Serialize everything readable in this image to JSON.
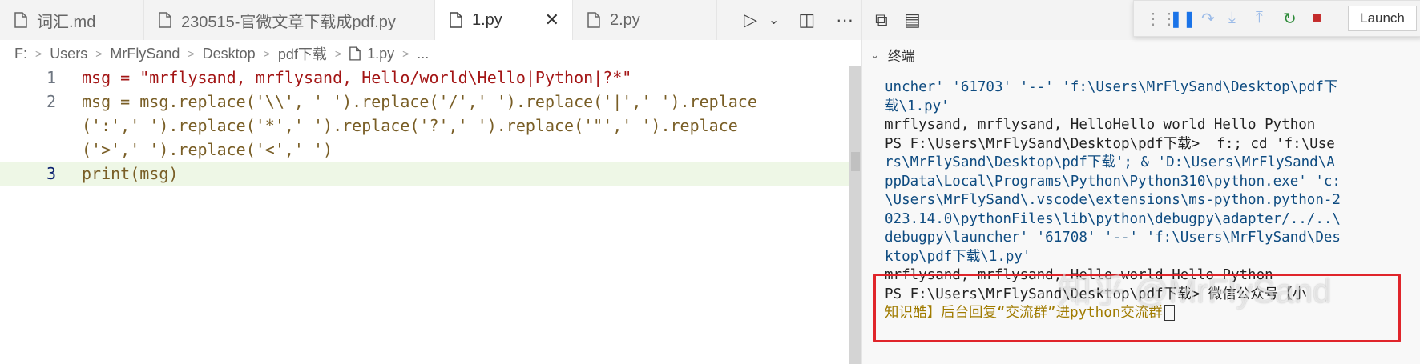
{
  "tabs": [
    {
      "label": "词汇.md",
      "active": false
    },
    {
      "label": "230515-官微文章下载成pdf.py",
      "active": false
    },
    {
      "label": "1.py",
      "active": true
    },
    {
      "label": "2.py",
      "active": false
    }
  ],
  "tab_actions": {
    "run": "▷",
    "run_dropdown": "⌄",
    "split": "◫",
    "more": "···"
  },
  "breadcrumb": {
    "items": [
      "F:",
      "Users",
      "MrFlySand",
      "Desktop",
      "pdf下载",
      "1.py",
      "..."
    ]
  },
  "code": {
    "lines": [
      {
        "num": "1",
        "text": "msg = \"mrflysand, mrflysand, Hello/world\\Hello|Python|?*\""
      },
      {
        "num": "2",
        "text": "msg = msg.replace('\\\\', ' ').replace('/',' ').replace('|',' ').replace"
      },
      {
        "num": "",
        "text": "(':',' ').replace('*',' ').replace('?',' ').replace('\"',' ').replace"
      },
      {
        "num": "",
        "text": "('>',' ').replace('<',' ')"
      },
      {
        "num": "3",
        "text": "print(msg)"
      }
    ]
  },
  "panel": {
    "title": "终端",
    "launch_label": "Launch"
  },
  "terminal": {
    "lines": [
      {
        "text": "uncher' '61703' '--' 'f:\\Users\\MrFlySand\\Desktop\\pdf下",
        "style": "blue"
      },
      {
        "text": "载\\1.py'",
        "style": "blue"
      },
      {
        "text": "mrflysand, mrflysand, HelloHello world Hello Python",
        "style": "dark"
      },
      {
        "text": "PS F:\\Users\\MrFlySand\\Desktop\\pdf下载>  f:; cd 'f:\\Use",
        "style": "dark"
      },
      {
        "text": "rs\\MrFlySand\\Desktop\\pdf下载'; & 'D:\\Users\\MrFlySand\\A",
        "style": "blue"
      },
      {
        "text": "ppData\\Local\\Programs\\Python\\Python310\\python.exe' 'c:",
        "style": "blue"
      },
      {
        "text": "\\Users\\MrFlySand\\.vscode\\extensions\\ms-python.python-2",
        "style": "blue"
      },
      {
        "text": "023.14.0\\pythonFiles\\lib\\python\\debugpy\\adapter/../..\\",
        "style": "blue"
      },
      {
        "text": "debugpy\\launcher' '61708' '--' 'f:\\Users\\MrFlySand\\Des",
        "style": "blue"
      },
      {
        "text": "ktop\\pdf下载\\1.py'",
        "style": "blue"
      },
      {
        "text": "mrflysand, mrflysand, Hello world Hello Python",
        "style": "dark"
      },
      {
        "text": "PS F:\\Users\\MrFlySand\\Desktop\\pdf下载> 微信公众号【小",
        "style": "dark_green"
      },
      {
        "text": "知识酷】后台回复“交流群”进python交流群",
        "style": "green"
      }
    ]
  },
  "watermark": "知乎 @MrFlySand",
  "colors": {
    "highlight_box": "#e0252b",
    "current_line": "#eef7e6"
  }
}
